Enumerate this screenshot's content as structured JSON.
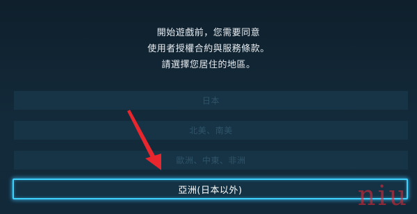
{
  "prompt": {
    "line1": "開始遊戲前，您需要同意",
    "line2": "使用者授權合約與服務條款。",
    "line3": "請選擇您居住的地區。"
  },
  "regions": [
    {
      "label": "日本",
      "selected": false
    },
    {
      "label": "北美、南美",
      "selected": false
    },
    {
      "label": "歐洲、中東、非洲",
      "selected": false
    },
    {
      "label": "亞洲(日本以外)",
      "selected": true
    }
  ],
  "annotation": {
    "arrow_color": "#e8262d"
  },
  "watermark": {
    "text": "niu"
  },
  "colors": {
    "background": "#112331",
    "button_idle": "#173446",
    "button_selected_border": "#3fd2ff"
  }
}
